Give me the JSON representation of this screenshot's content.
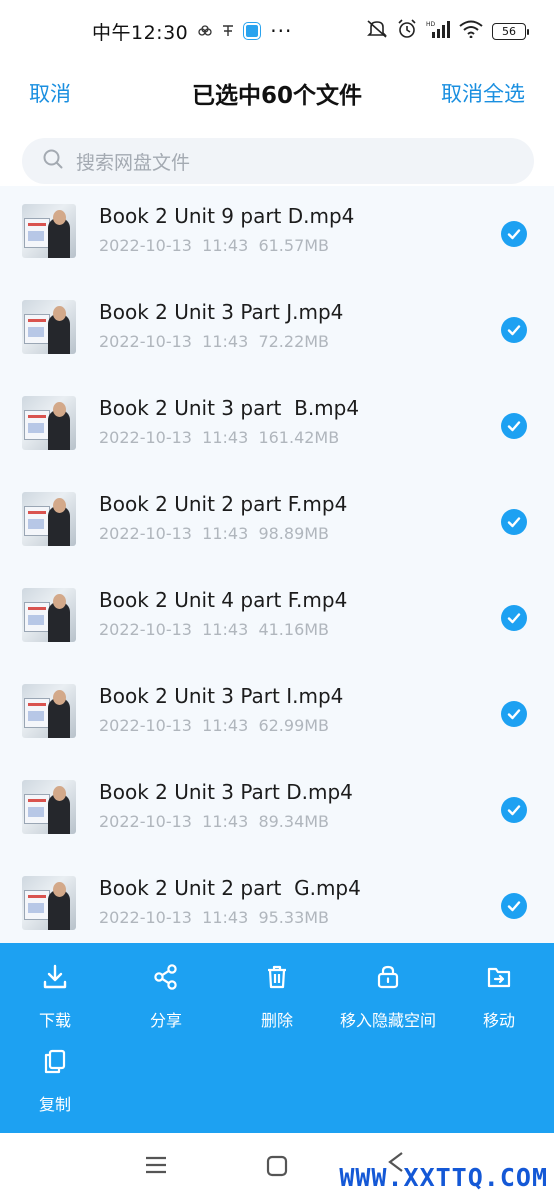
{
  "status_bar": {
    "time": "中午12:30",
    "battery": "56"
  },
  "header": {
    "cancel": "取消",
    "title": "已选中60个文件",
    "deselect_all": "取消全选"
  },
  "search": {
    "placeholder": "搜索网盘文件"
  },
  "files": [
    {
      "name": "Book 2 Unit 9 part D.mp4",
      "meta": "2022-10-13  11:43  61.57MB",
      "selected": true
    },
    {
      "name": "Book 2 Unit 3 Part J.mp4",
      "meta": "2022-10-13  11:43  72.22MB",
      "selected": true
    },
    {
      "name": "Book 2 Unit 3 part  B.mp4",
      "meta": "2022-10-13  11:43  161.42MB",
      "selected": true
    },
    {
      "name": "Book 2 Unit 2 part F.mp4",
      "meta": "2022-10-13  11:43  98.89MB",
      "selected": true
    },
    {
      "name": "Book 2 Unit 4 part F.mp4",
      "meta": "2022-10-13  11:43  41.16MB",
      "selected": true
    },
    {
      "name": "Book 2 Unit 3 Part I.mp4",
      "meta": "2022-10-13  11:43  62.99MB",
      "selected": true
    },
    {
      "name": "Book 2 Unit 3 Part D.mp4",
      "meta": "2022-10-13  11:43  89.34MB",
      "selected": true
    },
    {
      "name": "Book 2 Unit 2 part  G.mp4",
      "meta": "2022-10-13  11:43  95.33MB",
      "selected": true
    }
  ],
  "actions": [
    {
      "label": "下载",
      "icon": "download-icon"
    },
    {
      "label": "分享",
      "icon": "share-icon"
    },
    {
      "label": "删除",
      "icon": "trash-icon"
    },
    {
      "label": "移入隐藏空间",
      "icon": "lock-icon"
    },
    {
      "label": "移动",
      "icon": "move-icon"
    },
    {
      "label": "复制",
      "icon": "copy-icon"
    }
  ],
  "watermark": "WWW.XXTTQ.COM",
  "colors": {
    "accent": "#1da1f2",
    "link": "#1a8fe0",
    "list_bg": "#f5f9fd",
    "meta_text": "#b0b6bd"
  }
}
